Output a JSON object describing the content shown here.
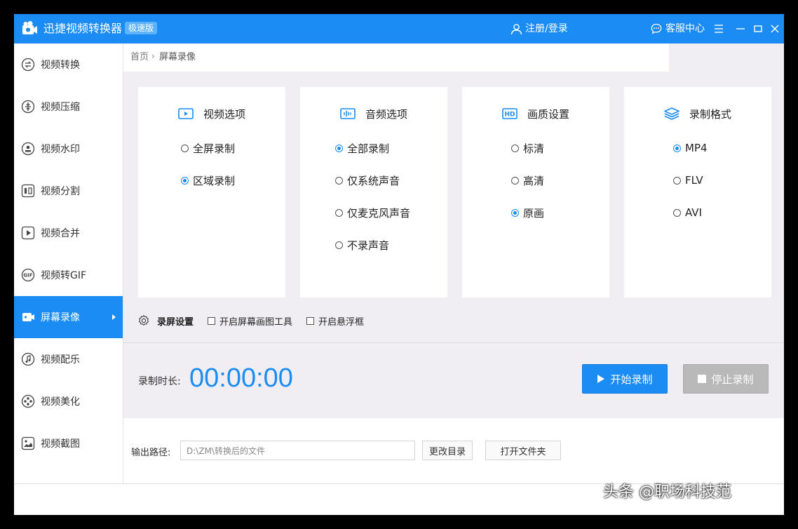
{
  "app": {
    "title": "迅捷视频转换器",
    "edition": "极速版",
    "login": "注册/登录",
    "service": "客服中心"
  },
  "sidebar": {
    "items": [
      {
        "label": "视频转换",
        "icon": "convert-icon"
      },
      {
        "label": "视频压缩",
        "icon": "compress-icon"
      },
      {
        "label": "视频水印",
        "icon": "watermark-icon"
      },
      {
        "label": "视频分割",
        "icon": "split-icon"
      },
      {
        "label": "视频合并",
        "icon": "merge-icon"
      },
      {
        "label": "视频转GIF",
        "icon": "gif-icon"
      },
      {
        "label": "屏幕录像",
        "icon": "screen-record-icon"
      },
      {
        "label": "视频配乐",
        "icon": "music-icon"
      },
      {
        "label": "视频美化",
        "icon": "beautify-icon"
      },
      {
        "label": "视频截图",
        "icon": "screenshot-icon"
      }
    ],
    "active_index": 6
  },
  "breadcrumb": {
    "home": "首页",
    "current": "屏幕录像"
  },
  "video_options": {
    "title": "视频选项",
    "options": [
      "全屏录制",
      "区域录制"
    ],
    "selected": 1
  },
  "audio_options": {
    "title": "音频选项",
    "options": [
      "全部录制",
      "仅系统声音",
      "仅麦克风声音",
      "不录声音"
    ],
    "selected": 0
  },
  "quality": {
    "title": "画质设置",
    "options": [
      "标清",
      "高清",
      "原画"
    ],
    "selected": 2
  },
  "format": {
    "title": "录制格式",
    "options": [
      "MP4",
      "FLV",
      "AVI"
    ],
    "selected": 0
  },
  "settings": {
    "label": "录屏设置",
    "check1": "开启屏幕画图工具",
    "check2": "开启悬浮框"
  },
  "recording": {
    "duration_label": "录制时长:",
    "duration": "00:00:00",
    "start": "开始录制",
    "stop": "停止录制"
  },
  "output": {
    "label": "输出路径:",
    "path": "D:\\ZM\\转换后的文件",
    "change": "更改目录",
    "open": "打开文件夹"
  },
  "watermark": "头条 @职场科技范",
  "colors": {
    "accent": "#1a8cf4",
    "disabled": "#b9b9b9"
  }
}
